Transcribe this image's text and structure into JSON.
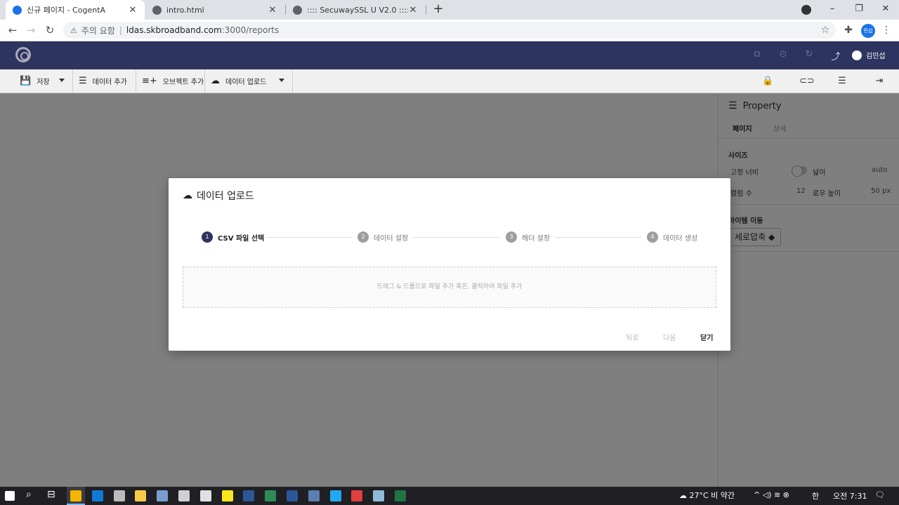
{
  "browser": {
    "tabs": [
      {
        "title": "신규 페이지 - CogentA",
        "favicon_color": "#1a73e8",
        "active": true
      },
      {
        "title": "intro.html",
        "favicon_color": "#5f6368",
        "active": false
      },
      {
        "title": ":::: SecuwaySSL U V2.0 ::::",
        "favicon_color": "#5f6368",
        "active": false
      }
    ],
    "close_glyph": "✕",
    "new_tab_glyph": "+",
    "window_controls": {
      "minimize": "–",
      "restore": "❐",
      "close": "✕"
    },
    "nav": {
      "back": "←",
      "forward": "→",
      "reload": "↻"
    },
    "address": {
      "security_icon": "⚠",
      "security_label": "주의 요함",
      "separator": "|",
      "host": "ldas.skbroadband.com",
      "path": ":3000/reports"
    },
    "toolbar_icons": {
      "star": "☆",
      "extensions": "✚",
      "menu": "⋮"
    },
    "profile_label": "민섭"
  },
  "app": {
    "header_icons": {
      "icon1": "⧉",
      "icon2": "⊙",
      "icon3": "↻",
      "share": "⤴"
    },
    "user_name": "김민섭",
    "toolbar": {
      "save_icon": "💾",
      "save_label": "저장",
      "add_data_icon": "☰",
      "add_data_label": "데이터 추가",
      "add_object_icon": "≡+",
      "add_object_label": "오브젝트 추가",
      "upload_icon": "☁",
      "upload_label": "데이터 업로드",
      "right_icons": {
        "lock": "🔒",
        "link": "⊂⊃",
        "database": "☰",
        "exit": "⇥"
      }
    },
    "property": {
      "title_icon": "☰",
      "title": "Property",
      "tabs": [
        "페이지",
        "상세"
      ],
      "size_section": "사이즈",
      "fixed_width_label": "고정 너비",
      "width_label": "넓이",
      "width_value": "auto",
      "column_count_label": "컬럼 수",
      "column_count_value": "12",
      "row_height_label": "로우 높이",
      "row_height_value": "50",
      "row_height_unit": "px",
      "item_move_label": "아이템 이동",
      "item_move_value": "세로압축 ◆"
    }
  },
  "modal": {
    "title_icon": "☁",
    "title": "데이터 업로드",
    "steps": [
      {
        "num": "1",
        "label": "CSV 파일 선택"
      },
      {
        "num": "2",
        "label": "데이터 설정"
      },
      {
        "num": "3",
        "label": "헤더 설정"
      },
      {
        "num": "4",
        "label": "데이터 생성"
      }
    ],
    "dropzone_text": "드래그 & 드롭으로 파일 추가 혹은, 클릭하여 파일 추가",
    "back_label": "뒤로",
    "next_label": "다음",
    "close_label": "닫기"
  },
  "taskbar": {
    "weather": "27°C 비 약간",
    "tray_icons": "^ ◁) ≋ ⊗",
    "ime": "한",
    "time": "오전 7:31",
    "notifications": "🗨",
    "search_icon": "⌕",
    "taskview_icon": "⊟",
    "apps": [
      {
        "name": "chrome",
        "color": "#f4b400"
      },
      {
        "name": "edge",
        "color": "#0f7bd6"
      },
      {
        "name": "settings",
        "color": "#bbbbbb"
      },
      {
        "name": "explorer",
        "color": "#f7c948"
      },
      {
        "name": "app5",
        "color": "#7a9ccf"
      },
      {
        "name": "app6",
        "color": "#d0d0d0"
      },
      {
        "name": "app7",
        "color": "#e0e0e0"
      },
      {
        "name": "sticky-notes",
        "color": "#f8e71c"
      },
      {
        "name": "terminal",
        "color": "#2b5797"
      },
      {
        "name": "app10",
        "color": "#2e8b57"
      },
      {
        "name": "word",
        "color": "#2b579a"
      },
      {
        "name": "app12",
        "color": "#5a7fb0"
      },
      {
        "name": "vscode",
        "color": "#23a9f2"
      },
      {
        "name": "app14",
        "color": "#e04040"
      },
      {
        "name": "app15",
        "color": "#8fbbd8"
      },
      {
        "name": "excel",
        "color": "#217346"
      }
    ]
  }
}
